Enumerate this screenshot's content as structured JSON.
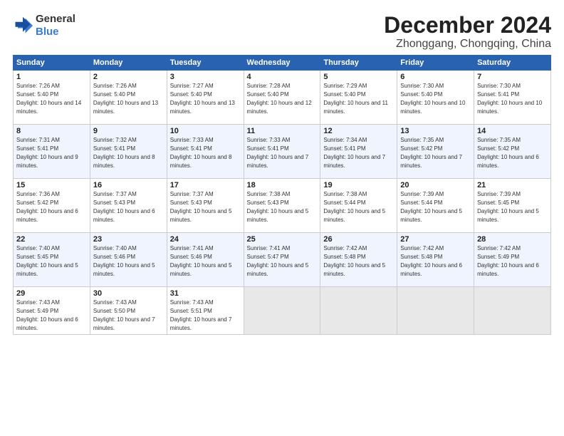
{
  "logo": {
    "general": "General",
    "blue": "Blue"
  },
  "header": {
    "month": "December 2024",
    "location": "Zhonggang, Chongqing, China"
  },
  "days_of_week": [
    "Sunday",
    "Monday",
    "Tuesday",
    "Wednesday",
    "Thursday",
    "Friday",
    "Saturday"
  ],
  "weeks": [
    [
      {
        "day": 1,
        "sunrise": "7:26 AM",
        "sunset": "5:40 PM",
        "daylight": "10 hours and 14 minutes."
      },
      {
        "day": 2,
        "sunrise": "7:26 AM",
        "sunset": "5:40 PM",
        "daylight": "10 hours and 13 minutes."
      },
      {
        "day": 3,
        "sunrise": "7:27 AM",
        "sunset": "5:40 PM",
        "daylight": "10 hours and 13 minutes."
      },
      {
        "day": 4,
        "sunrise": "7:28 AM",
        "sunset": "5:40 PM",
        "daylight": "10 hours and 12 minutes."
      },
      {
        "day": 5,
        "sunrise": "7:29 AM",
        "sunset": "5:40 PM",
        "daylight": "10 hours and 11 minutes."
      },
      {
        "day": 6,
        "sunrise": "7:30 AM",
        "sunset": "5:40 PM",
        "daylight": "10 hours and 10 minutes."
      },
      {
        "day": 7,
        "sunrise": "7:30 AM",
        "sunset": "5:41 PM",
        "daylight": "10 hours and 10 minutes."
      }
    ],
    [
      {
        "day": 8,
        "sunrise": "7:31 AM",
        "sunset": "5:41 PM",
        "daylight": "10 hours and 9 minutes."
      },
      {
        "day": 9,
        "sunrise": "7:32 AM",
        "sunset": "5:41 PM",
        "daylight": "10 hours and 8 minutes."
      },
      {
        "day": 10,
        "sunrise": "7:33 AM",
        "sunset": "5:41 PM",
        "daylight": "10 hours and 8 minutes."
      },
      {
        "day": 11,
        "sunrise": "7:33 AM",
        "sunset": "5:41 PM",
        "daylight": "10 hours and 7 minutes."
      },
      {
        "day": 12,
        "sunrise": "7:34 AM",
        "sunset": "5:41 PM",
        "daylight": "10 hours and 7 minutes."
      },
      {
        "day": 13,
        "sunrise": "7:35 AM",
        "sunset": "5:42 PM",
        "daylight": "10 hours and 7 minutes."
      },
      {
        "day": 14,
        "sunrise": "7:35 AM",
        "sunset": "5:42 PM",
        "daylight": "10 hours and 6 minutes."
      }
    ],
    [
      {
        "day": 15,
        "sunrise": "7:36 AM",
        "sunset": "5:42 PM",
        "daylight": "10 hours and 6 minutes."
      },
      {
        "day": 16,
        "sunrise": "7:37 AM",
        "sunset": "5:43 PM",
        "daylight": "10 hours and 6 minutes."
      },
      {
        "day": 17,
        "sunrise": "7:37 AM",
        "sunset": "5:43 PM",
        "daylight": "10 hours and 5 minutes."
      },
      {
        "day": 18,
        "sunrise": "7:38 AM",
        "sunset": "5:43 PM",
        "daylight": "10 hours and 5 minutes."
      },
      {
        "day": 19,
        "sunrise": "7:38 AM",
        "sunset": "5:44 PM",
        "daylight": "10 hours and 5 minutes."
      },
      {
        "day": 20,
        "sunrise": "7:39 AM",
        "sunset": "5:44 PM",
        "daylight": "10 hours and 5 minutes."
      },
      {
        "day": 21,
        "sunrise": "7:39 AM",
        "sunset": "5:45 PM",
        "daylight": "10 hours and 5 minutes."
      }
    ],
    [
      {
        "day": 22,
        "sunrise": "7:40 AM",
        "sunset": "5:45 PM",
        "daylight": "10 hours and 5 minutes."
      },
      {
        "day": 23,
        "sunrise": "7:40 AM",
        "sunset": "5:46 PM",
        "daylight": "10 hours and 5 minutes."
      },
      {
        "day": 24,
        "sunrise": "7:41 AM",
        "sunset": "5:46 PM",
        "daylight": "10 hours and 5 minutes."
      },
      {
        "day": 25,
        "sunrise": "7:41 AM",
        "sunset": "5:47 PM",
        "daylight": "10 hours and 5 minutes."
      },
      {
        "day": 26,
        "sunrise": "7:42 AM",
        "sunset": "5:48 PM",
        "daylight": "10 hours and 5 minutes."
      },
      {
        "day": 27,
        "sunrise": "7:42 AM",
        "sunset": "5:48 PM",
        "daylight": "10 hours and 6 minutes."
      },
      {
        "day": 28,
        "sunrise": "7:42 AM",
        "sunset": "5:49 PM",
        "daylight": "10 hours and 6 minutes."
      }
    ],
    [
      {
        "day": 29,
        "sunrise": "7:43 AM",
        "sunset": "5:49 PM",
        "daylight": "10 hours and 6 minutes."
      },
      {
        "day": 30,
        "sunrise": "7:43 AM",
        "sunset": "5:50 PM",
        "daylight": "10 hours and 7 minutes."
      },
      {
        "day": 31,
        "sunrise": "7:43 AM",
        "sunset": "5:51 PM",
        "daylight": "10 hours and 7 minutes."
      },
      null,
      null,
      null,
      null
    ]
  ]
}
